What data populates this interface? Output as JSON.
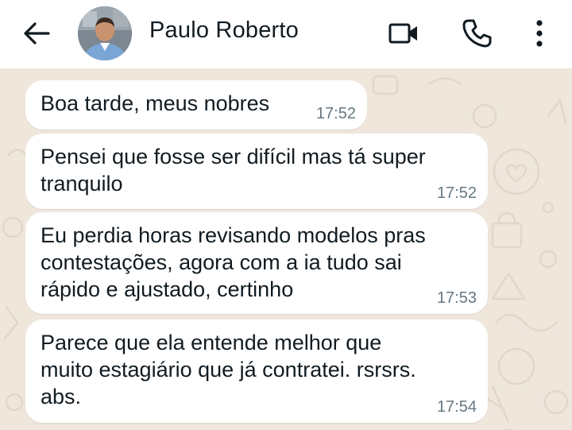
{
  "header": {
    "contact_name": "Paulo Roberto",
    "icons": {
      "back": "arrow-left-icon",
      "avatar": "profile-photo",
      "video": "video-camera-icon",
      "call": "phone-icon",
      "menu": "more-vertical-icon"
    }
  },
  "messages": [
    {
      "text": "Boa tarde, meus nobres",
      "time": "17:52"
    },
    {
      "text": "Pensei que fosse ser difícil mas tá super\ntranquilo",
      "time": "17:52"
    },
    {
      "text": "Eu perdia horas revisando modelos pras\ncontestações, agora com a ia tudo sai\nrápido e ajustado, certinho",
      "time": "17:53"
    },
    {
      "text": "Parece que ela entende melhor que\nmuito estagiário que já contratei. rsrsrs.\nabs.",
      "time": "17:54"
    }
  ],
  "colors": {
    "header_bg": "#ffffff",
    "chat_bg": "#efe7dc",
    "bubble_bg": "#ffffff",
    "text": "#111b21",
    "time": "#667781"
  }
}
